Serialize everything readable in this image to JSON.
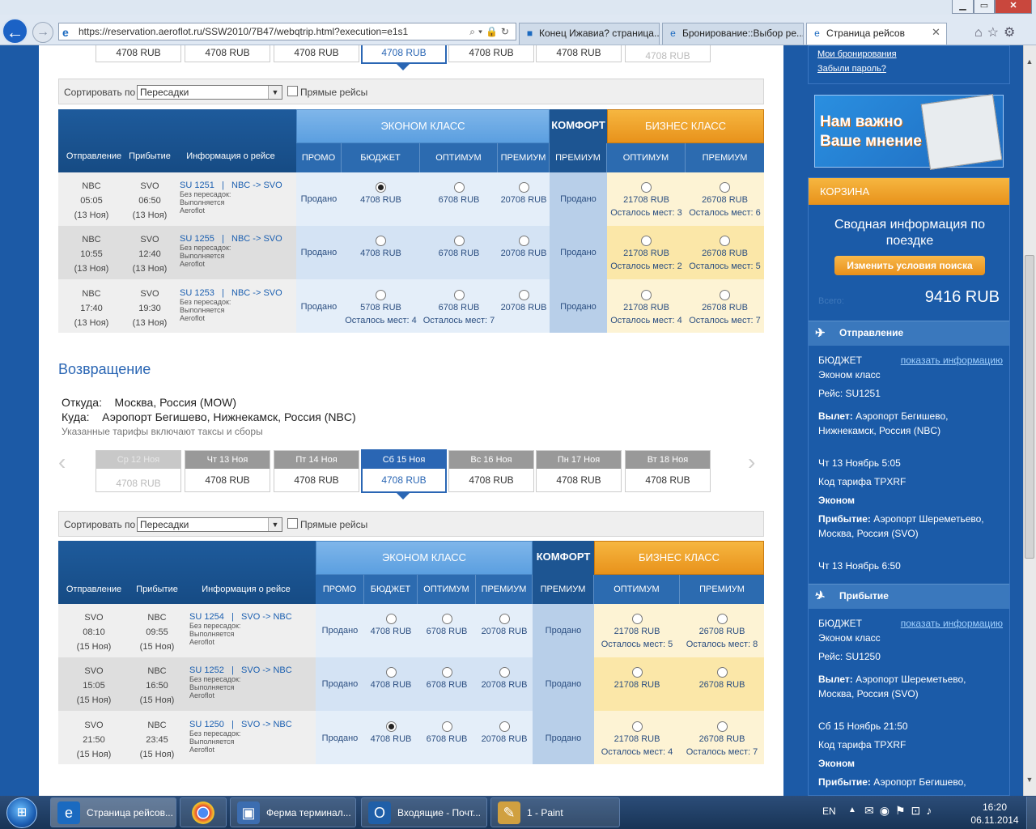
{
  "browser": {
    "url": "https://reservation.aeroflot.ru/SSW2010/7B47/webqtrip.html?execution=e1s1",
    "tabs": [
      {
        "label": "Конец Ижавиа? страница..."
      },
      {
        "label": "Бронирование::Выбор ре..."
      },
      {
        "label": "Страница рейсов"
      }
    ]
  },
  "outbound": {
    "prices": [
      "4708 RUB",
      "4708 RUB",
      "4708 RUB",
      "4708 RUB",
      "4708 RUB",
      "4708 RUB",
      "4708 RUB"
    ],
    "sort_label": "Сортировать по",
    "sort_value": "Пересадки",
    "direct_label": "Прямые рейсы",
    "headers": {
      "economy": "ЭКОНОМ КЛАСС",
      "comfort": "КОМФОРТ",
      "business": "БИЗНЕС КЛАСС",
      "depart": "Отправление",
      "arrive": "Прибытие",
      "info": "Информация о рейсе",
      "promo": "ПРОМО",
      "budget": "БЮДЖЕТ",
      "optimum": "ОПТИМУМ",
      "premium": "ПРЕМИУМ",
      "c_premium": "ПРЕМИУМ",
      "b_optimum": "ОПТИМУМ",
      "b_premium": "ПРЕМИУМ"
    },
    "rows": [
      {
        "from": "NBC",
        "dep_time": "05:05",
        "dep_date": "(13 Ноя)",
        "to": "SVO",
        "arr_time": "06:50",
        "arr_date": "(13 Ноя)",
        "flight": "SU 1251",
        "route": "NBC -> SVO",
        "note1": "Без пересадок:",
        "note2": "Выполняется",
        "carrier": "Aeroflot",
        "promo": "Продано",
        "budget": "4708 RUB",
        "budget_seats": "",
        "optimum": "6708 RUB",
        "optimum_seats": "",
        "premium": "20708 RUB",
        "comfort": "Продано",
        "b_opt": "21708 RUB",
        "b_opt_seats": "Осталось мест: 3",
        "b_prem": "26708 RUB",
        "b_prem_seats": "Осталось мест: 6"
      },
      {
        "from": "NBC",
        "dep_time": "10:55",
        "dep_date": "(13 Ноя)",
        "to": "SVO",
        "arr_time": "12:40",
        "arr_date": "(13 Ноя)",
        "flight": "SU 1255",
        "route": "NBC -> SVO",
        "note1": "Без пересадок:",
        "note2": "Выполняется",
        "carrier": "Aeroflot",
        "promo": "Продано",
        "budget": "4708 RUB",
        "budget_seats": "",
        "optimum": "6708 RUB",
        "optimum_seats": "",
        "premium": "20708 RUB",
        "comfort": "Продано",
        "b_opt": "21708 RUB",
        "b_opt_seats": "Осталось мест: 2",
        "b_prem": "26708 RUB",
        "b_prem_seats": "Осталось мест: 5"
      },
      {
        "from": "NBC",
        "dep_time": "17:40",
        "dep_date": "(13 Ноя)",
        "to": "SVO",
        "arr_time": "19:30",
        "arr_date": "(13 Ноя)",
        "flight": "SU 1253",
        "route": "NBC -> SVO",
        "note1": "Без пересадок:",
        "note2": "Выполняется",
        "carrier": "Aeroflot",
        "promo": "Продано",
        "budget": "5708 RUB",
        "budget_seats": "Осталось мест: 4",
        "optimum": "6708 RUB",
        "optimum_seats": "Осталось мест: 7",
        "premium": "20708 RUB",
        "comfort": "Продано",
        "b_opt": "21708 RUB",
        "b_opt_seats": "Осталось мест: 4",
        "b_prem": "26708 RUB",
        "b_prem_seats": "Осталось мест: 7"
      }
    ]
  },
  "return": {
    "title": "Возвращение",
    "from_label": "Откуда:",
    "from_value": "Москва, Россия (MOW)",
    "to_label": "Куда:",
    "to_value": "Аэропорт Бегишево, Нижнекамск, Россия (NBC)",
    "tax_note": "Указанные тарифы включают таксы и сборы",
    "dates": [
      {
        "day": "Ср 12 Ноя",
        "price": "4708 RUB"
      },
      {
        "day": "Чт 13 Ноя",
        "price": "4708 RUB"
      },
      {
        "day": "Пт 14 Ноя",
        "price": "4708 RUB"
      },
      {
        "day": "Сб 15 Ноя",
        "price": "4708 RUB"
      },
      {
        "day": "Вс 16 Ноя",
        "price": "4708 RUB"
      },
      {
        "day": "Пн 17 Ноя",
        "price": "4708 RUB"
      },
      {
        "day": "Вт 18 Ноя",
        "price": "4708 RUB"
      }
    ],
    "sort_label": "Сортировать по",
    "sort_value": "Пересадки",
    "direct_label": "Прямые рейсы",
    "headers": {
      "economy": "ЭКОНОМ КЛАСС",
      "comfort": "КОМФОРТ",
      "business": "БИЗНЕС КЛАСС",
      "depart": "Отправление",
      "arrive": "Прибытие",
      "info": "Информация о рейсе",
      "promo": "ПРОМО",
      "budget": "БЮДЖЕТ",
      "optimum": "ОПТИМУМ",
      "premium": "ПРЕМИУМ",
      "c_premium": "ПРЕМИУМ",
      "b_optimum": "ОПТИМУМ",
      "b_premium": "ПРЕМИУМ"
    },
    "rows": [
      {
        "from": "SVO",
        "dep_time": "08:10",
        "dep_date": "(15 Ноя)",
        "to": "NBC",
        "arr_time": "09:55",
        "arr_date": "(15 Ноя)",
        "flight": "SU 1254",
        "route": "SVO -> NBC",
        "note1": "Без пересадок:",
        "note2": "Выполняется",
        "carrier": "Aeroflot",
        "promo": "Продано",
        "budget": "4708 RUB",
        "optimum": "6708 RUB",
        "premium": "20708 RUB",
        "comfort": "Продано",
        "b_opt": "21708 RUB",
        "b_opt_seats": "Осталось мест: 5",
        "b_prem": "26708 RUB",
        "b_prem_seats": "Осталось мест: 8"
      },
      {
        "from": "SVO",
        "dep_time": "15:05",
        "dep_date": "(15 Ноя)",
        "to": "NBC",
        "arr_time": "16:50",
        "arr_date": "(15 Ноя)",
        "flight": "SU 1252",
        "route": "SVO -> NBC",
        "note1": "Без пересадок:",
        "note2": "Выполняется",
        "carrier": "Aeroflot",
        "promo": "Продано",
        "budget": "4708 RUB",
        "optimum": "6708 RUB",
        "premium": "20708 RUB",
        "comfort": "Продано",
        "b_opt": "21708 RUB",
        "b_opt_seats": "",
        "b_prem": "26708 RUB",
        "b_prem_seats": ""
      },
      {
        "from": "SVO",
        "dep_time": "21:50",
        "dep_date": "(15 Ноя)",
        "to": "NBC",
        "arr_time": "23:45",
        "arr_date": "(15 Ноя)",
        "flight": "SU 1250",
        "route": "SVO -> NBC",
        "note1": "Без пересадок:",
        "note2": "Выполняется",
        "carrier": "Aeroflot",
        "promo": "Продано",
        "budget": "4708 RUB",
        "optimum": "6708 RUB",
        "premium": "20708 RUB",
        "comfort": "Продано",
        "b_opt": "21708 RUB",
        "b_opt_seats": "Осталось мест: 4",
        "b_prem": "26708 RUB",
        "b_prem_seats": "Осталось мест: 7"
      }
    ]
  },
  "right": {
    "my_bookings": "Мои бронирования",
    "forgot_password": "Забыли пароль?",
    "banner_line1": "Нам важно",
    "banner_line2": "Ваше мнение",
    "cart_title": "КОРЗИНА",
    "summary_title": "Сводная информация по поездке",
    "change_search": "Изменить условия поиска",
    "total_label": "Всего:",
    "total_value": "9416 RUB",
    "departure_header": "Отправление",
    "arrival_header": "Прибытие",
    "show_info": "показать информацию",
    "dep": {
      "fare": "БЮДЖЕТ",
      "cls": "Эконом класс",
      "flight": "Рейс: SU1251",
      "dep_label": "Вылет:",
      "dep_place": "Аэропорт Бегишево, Нижнекамск, Россия (NBC)",
      "dep_time": "Чт 13 Ноябрь 5:05",
      "tariff": "Код тарифа TPXRF",
      "econ": "Эконом",
      "arr_label": "Прибытие:",
      "arr_place": "Аэропорт Шереметьево, Москва, Россия (SVO)",
      "arr_time": "Чт 13 Ноябрь 6:50"
    },
    "ret": {
      "fare": "БЮДЖЕТ",
      "cls": "Эконом класс",
      "flight": "Рейс: SU1250",
      "dep_label": "Вылет:",
      "dep_place": "Аэропорт Шереметьево, Москва, Россия (SVO)",
      "dep_time": "Сб 15 Ноябрь 21:50",
      "tariff": "Код тарифа TPXRF",
      "econ": "Эконом",
      "arr_label": "Прибытие:",
      "arr_place": "Аэропорт Бегишево,"
    }
  },
  "taskbar": {
    "items": [
      {
        "label": "Страница рейсов..."
      },
      {
        "label": ""
      },
      {
        "label": "Ферма терминал..."
      },
      {
        "label": "Входящие - Почт..."
      },
      {
        "label": "1 - Paint"
      }
    ],
    "lang": "EN",
    "time": "16:20",
    "date": "06.11.2014"
  }
}
